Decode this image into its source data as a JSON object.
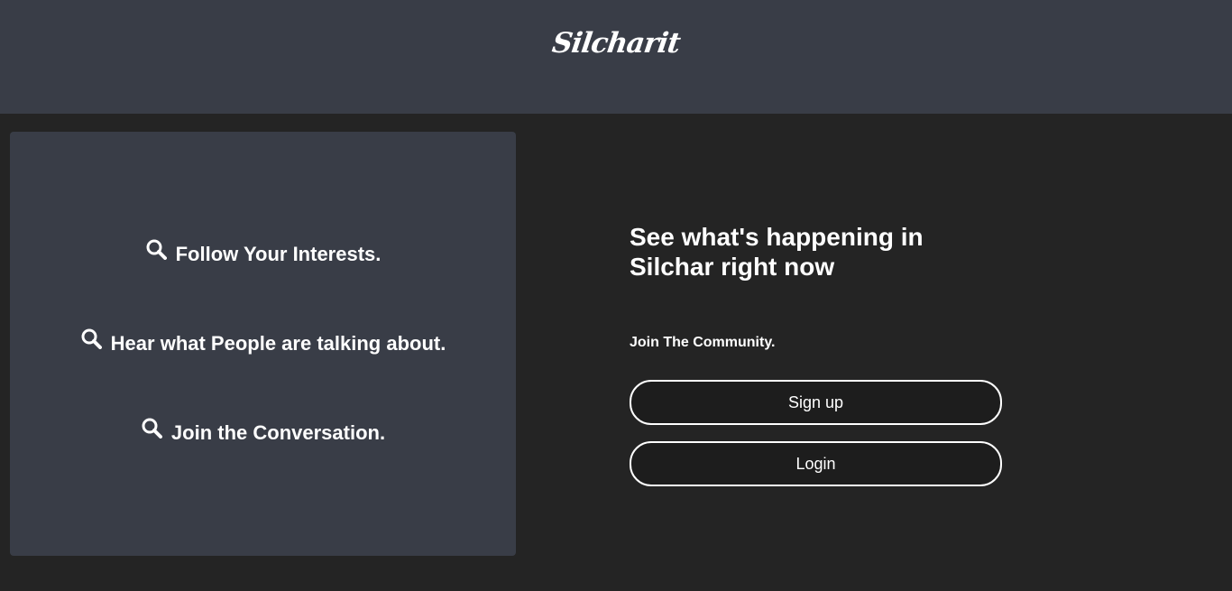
{
  "header": {
    "logo_text": "Silcharit"
  },
  "features": [
    {
      "icon": "search-icon",
      "label": "Follow Your Interests."
    },
    {
      "icon": "search-icon",
      "label": "Hear what People are talking about."
    },
    {
      "icon": "search-icon",
      "label": "Join the Conversation."
    }
  ],
  "main": {
    "headline": "See what's happening in Silchar right now",
    "subhead": "Join The Community.",
    "signup_label": "Sign up",
    "login_label": "Login"
  },
  "colors": {
    "header_bg": "#393d47",
    "page_bg": "#242424",
    "panel_bg": "#393d47",
    "button_bg": "#1d1d1d",
    "text": "#ffffff"
  }
}
